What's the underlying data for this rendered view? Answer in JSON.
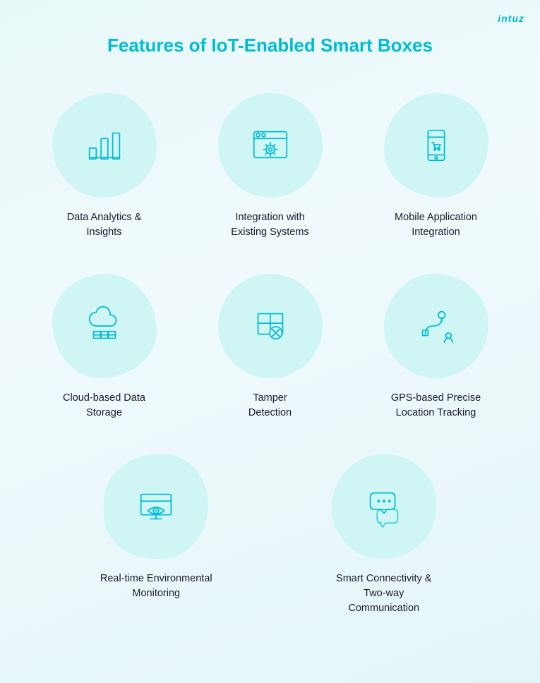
{
  "brand": "intuz",
  "title": {
    "prefix": "Features of ",
    "highlight": "IoT-Enabled Smart Boxes"
  },
  "features_row1": [
    {
      "id": "data-analytics",
      "label": "Data Analytics &\nInsights",
      "icon": "bar-chart"
    },
    {
      "id": "integration",
      "label": "Integration with\nExisting Systems",
      "icon": "browser-gear"
    },
    {
      "id": "mobile-app",
      "label": "Mobile Application\nIntegration",
      "icon": "mobile-cart"
    }
  ],
  "features_row2": [
    {
      "id": "cloud-storage",
      "label": "Cloud-based Data\nStorage",
      "icon": "cloud-storage"
    },
    {
      "id": "tamper-detection",
      "label": "Tamper\nDetection",
      "icon": "tamper"
    },
    {
      "id": "gps-tracking",
      "label": "GPS-based Precise\nLocation Tracking",
      "icon": "gps"
    }
  ],
  "features_row3": [
    {
      "id": "environmental",
      "label": "Real-time Environmental\nMonitoring",
      "icon": "eye-monitor"
    },
    {
      "id": "connectivity",
      "label": "Smart Connectivity &\nTwo-way Communication",
      "icon": "chat"
    }
  ]
}
